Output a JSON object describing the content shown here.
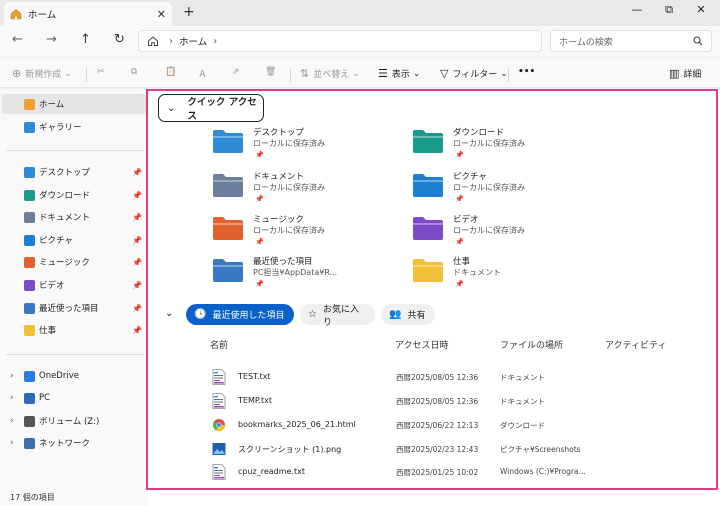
{
  "tab": {
    "title": "ホーム",
    "close": "✕",
    "new_tab": "+"
  },
  "window": {
    "minimize": "—",
    "maximize": "⧉",
    "close": "✕"
  },
  "address": {
    "root_icon": "home-icon",
    "crumb": "ホーム",
    "separator": "›"
  },
  "search": {
    "placeholder": "ホームの検索"
  },
  "toolbar": {
    "new": "新規作成",
    "sort": "並べ替え",
    "view": "表示",
    "filter": "フィルター",
    "more": "•••",
    "details": "詳細"
  },
  "sidebar": {
    "home": "ホーム",
    "gallery": "ギャラリー",
    "pinned": [
      {
        "label": "デスクトップ",
        "color": "#2e8bd6"
      },
      {
        "label": "ダウンロード",
        "color": "#1a9a8a"
      },
      {
        "label": "ドキュメント",
        "color": "#6b7f9c"
      },
      {
        "label": "ピクチャ",
        "color": "#1d7fd1"
      },
      {
        "label": "ミュージック",
        "color": "#e0622e"
      },
      {
        "label": "ビデオ",
        "color": "#7d4ac9"
      },
      {
        "label": "最近使った項目",
        "color": "#3a78c2"
      },
      {
        "label": "仕事",
        "color": "#f2c037"
      }
    ],
    "drives": [
      {
        "label": "OneDrive",
        "color": "#2a7be4"
      },
      {
        "label": "PC",
        "color": "#2a6ab8"
      },
      {
        "label": "ボリューム (Z:)",
        "color": "#555555"
      },
      {
        "label": "ネットワーク",
        "color": "#3d6fa8"
      }
    ],
    "pin_glyph": "📌",
    "expand_glyph": "›"
  },
  "status": "17 個の項目",
  "quick_access": {
    "title": "クイック アクセス",
    "chevron": "⌄",
    "items": [
      {
        "name": "デスクトップ",
        "location": "ローカルに保存済み",
        "color": "#2e8bd6"
      },
      {
        "name": "ダウンロード",
        "location": "ローカルに保存済み",
        "color": "#1a9a8a"
      },
      {
        "name": "ドキュメント",
        "location": "ローカルに保存済み",
        "color": "#6b7f9c"
      },
      {
        "name": "ピクチャ",
        "location": "ローカルに保存済み",
        "color": "#1d7fd1"
      },
      {
        "name": "ミュージック",
        "location": "ローカルに保存済み",
        "color": "#e0622e"
      },
      {
        "name": "ビデオ",
        "location": "ローカルに保存済み",
        "color": "#7d4ac9"
      },
      {
        "name": "最近使った項目",
        "location": "PC担当¥AppData¥R...",
        "color": "#3a78c2"
      },
      {
        "name": "仕事",
        "location": "ドキュメント",
        "color": "#f2c037"
      }
    ]
  },
  "recent": {
    "chevron": "⌄",
    "tabs": [
      "最近使用した項目",
      "お気に入り",
      "共有"
    ],
    "columns": [
      "名前",
      "アクセス日時",
      "ファイルの場所",
      "アクティビティ"
    ],
    "rows": [
      {
        "name": "TEST.txt",
        "date": "西暦2025/08/05 12:36",
        "location": "ドキュメント",
        "icon": "text-file-icon"
      },
      {
        "name": "TEMP.txt",
        "date": "西暦2025/08/05 12:36",
        "location": "ドキュメント",
        "icon": "text-file-icon"
      },
      {
        "name": "bookmarks_2025_06_21.html",
        "date": "西暦2025/06/22 12:13",
        "location": "ダウンロード",
        "icon": "chrome-icon"
      },
      {
        "name": "スクリーンショット (1).png",
        "date": "西暦2025/02/23 12:43",
        "location": "ピクチャ¥Screenshots",
        "icon": "image-file-icon"
      },
      {
        "name": "cpuz_readme.txt",
        "date": "西暦2025/01/25 10:02",
        "location": "Windows (C:)¥Progra...",
        "icon": "text-file-icon"
      }
    ]
  },
  "accent_color": "#0a62c9",
  "highlight_color": "#e53a83"
}
